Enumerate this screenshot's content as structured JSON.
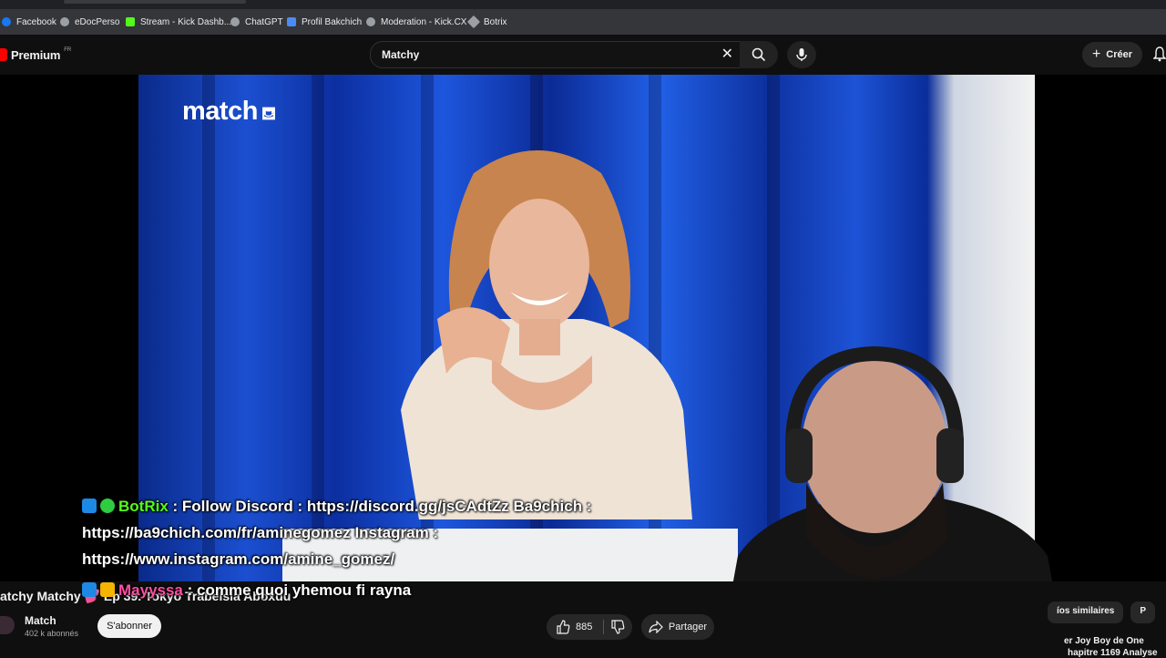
{
  "bookmarks": [
    {
      "label": "Facebook",
      "color": "#1877f2"
    },
    {
      "label": "eDocPerso",
      "color": "#9aa0a6"
    },
    {
      "label": "Stream - Kick Dashb...",
      "color": "#53fc18"
    },
    {
      "label": "ChatGPT",
      "color": "#9aa0a6"
    },
    {
      "label": "Profil Bakchich",
      "color": "#4b8bf5"
    },
    {
      "label": "Moderation - Kick.CX",
      "color": "#9aa0a6"
    },
    {
      "label": "Botrix",
      "color": "#9aa0a6"
    }
  ],
  "header": {
    "logo": "Premium",
    "logo_region": "FR",
    "search_value": "Matchy",
    "create_label": "Créer"
  },
  "video": {
    "brand_logo": "match"
  },
  "chat": {
    "msg1_user": "BotRix",
    "msg1_user_color": "#53fc18",
    "msg1_line1": " : Follow Discord : https://discord.gg/jsCAdtZz Ba9chich :",
    "msg1_line2": "https://ba9chich.com/fr/aminegomez Instagram :",
    "msg1_line3": "https://www.instagram.com/amine_gomez/",
    "msg2_user": "Mayyssa",
    "msg2_user_color": "#ff4fa3",
    "msg2_text": " : comme quoi yhemou fi rayna"
  },
  "below": {
    "title": "atchy Matchy 💕 Ep 39. Tokyo Trabelsia Aboxdu",
    "channel": "Match",
    "subscribers": "402 k abonnés",
    "subscribe_label": "S'abonner",
    "like_count": "885",
    "share_label": "Partager",
    "chip1": "íos similaires",
    "chip2": "P",
    "rec_line1": "er Joy Boy de One",
    "rec_line2": "hapitre 1169 Analyse"
  }
}
